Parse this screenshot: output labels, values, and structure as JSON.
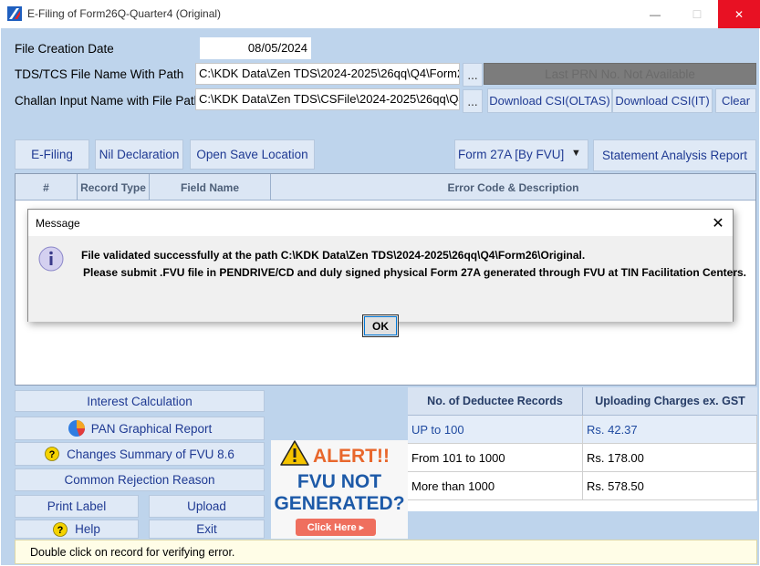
{
  "window": {
    "title": "E-Filing of Form26Q-Quarter4 (Original)",
    "minimize": "—",
    "maximize": "☐",
    "close": "✕"
  },
  "form": {
    "creation_date_label": "File Creation Date",
    "creation_date": "08/05/2024",
    "tds_file_label": "TDS/TCS File Name With Path",
    "tds_file_path": "C:\\KDK Data\\Zen TDS\\2024-2025\\26qq\\Q4\\Form2",
    "browse_label": "...",
    "last_prn": "Last PRN No. Not Available",
    "challan_label": "Challan Input Name with File Path",
    "challan_path": "C:\\KDK Data\\Zen TDS\\CSFile\\2024-2025\\26qq\\Q4",
    "download_oltas": "Download CSI(OLTAS)",
    "download_it": "Download CSI(IT)",
    "clear": "Clear"
  },
  "toolbar": {
    "efiling": "E-Filing",
    "nil_declaration": "Nil Declaration",
    "open_save_location": "Open Save Location",
    "form_select": "Form 27A [By FVU]",
    "statement_analysis": "Statement Analysis Report"
  },
  "grid": {
    "columns": [
      "#",
      "Record Type",
      "Field Name",
      "Error Code & Description"
    ]
  },
  "dialog": {
    "title": "Message",
    "line1": "File validated successfully at the path C:\\KDK Data\\Zen TDS\\2024-2025\\26qq\\Q4\\Form26\\Original.",
    "line2": "Please submit .FVU file in PENDRIVE/CD and duly signed physical Form 27A generated through FVU at TIN Facilitation Centers.",
    "ok": "OK"
  },
  "left_buttons": {
    "interest_calc": "Interest Calculation",
    "pan_report": "PAN Graphical Report",
    "changes_summary": "Changes Summary of FVU 8.6",
    "common_rejection": "Common Rejection Reason",
    "print_label": "Print Label",
    "upload": "Upload",
    "help": "Help",
    "exit": "Exit"
  },
  "alert": {
    "title": "ALERT!!",
    "line1": "FVU NOT",
    "line2": "GENERATED?",
    "cta": "Click Here ▸"
  },
  "charges": {
    "headers": [
      "No. of Deductee Records",
      "Uploading Charges ex. GST"
    ],
    "rows": [
      {
        "range": "UP to 100",
        "charge": "Rs. 42.37"
      },
      {
        "range": "From 101 to 1000",
        "charge": "Rs. 178.00"
      },
      {
        "range": "More than 1000",
        "charge": "Rs. 578.50"
      }
    ]
  },
  "status": {
    "text": "Double click on record for verifying error."
  },
  "colors": {
    "client_bg": "#bed4ec",
    "link_text": "#1f3a93",
    "alert_orange": "#e8672c",
    "alert_blue": "#1d5aa8"
  }
}
